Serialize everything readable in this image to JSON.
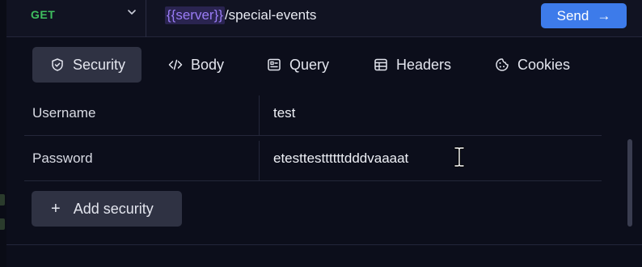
{
  "request": {
    "method": "GET",
    "url_variable": "{{server}}",
    "url_path": "/special-events",
    "send_label": "Send",
    "send_arrow": "→"
  },
  "tabs": [
    {
      "label": "Security",
      "icon": "shield-icon",
      "active": true
    },
    {
      "label": "Body",
      "icon": "code-icon",
      "active": false
    },
    {
      "label": "Query",
      "icon": "query-icon",
      "active": false
    },
    {
      "label": "Headers",
      "icon": "table-icon",
      "active": false
    },
    {
      "label": "Cookies",
      "icon": "cookie-icon",
      "active": false
    }
  ],
  "security": {
    "rows": [
      {
        "key": "Username",
        "value": "test"
      },
      {
        "key": "Password",
        "value": "etesttesttttttdddvaaaat"
      }
    ],
    "add_label": "Add security",
    "add_icon": "+"
  },
  "colors": {
    "accent": "#3d7bea",
    "method_get": "#3fbf5f",
    "variable": "#9a7cf6"
  }
}
